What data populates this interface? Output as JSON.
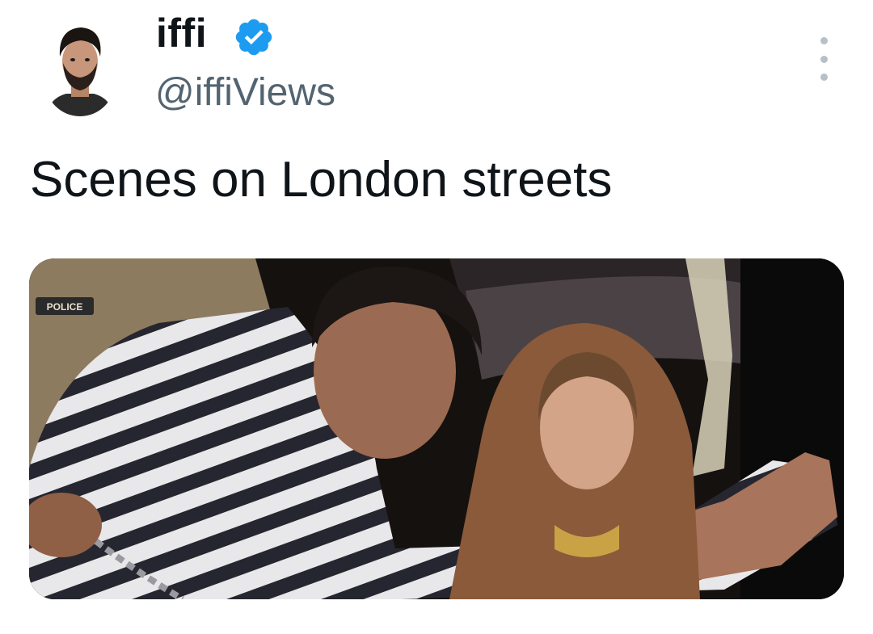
{
  "tweet": {
    "author": {
      "display_name": "iffi",
      "handle": "@iffiViews",
      "verified": true,
      "avatar_icon": "profile-photo",
      "verified_icon": "verified-badge-icon"
    },
    "more_icon": "more-options-icon",
    "text": "Scenes on London streets",
    "media": {
      "image_icon": "photo",
      "patch_text": "POLICE"
    }
  },
  "colors": {
    "text_primary": "#0f1419",
    "text_secondary": "#536471",
    "verified_blue": "#1d9bf0",
    "more_dots": "#b6c0c8"
  }
}
